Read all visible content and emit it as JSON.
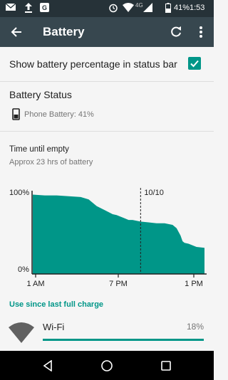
{
  "status_bar": {
    "network_label": "4G",
    "battery_percent": "41%",
    "time": "1:53",
    "icons": [
      "mail-icon",
      "upload-icon",
      "google-icon",
      "alarm-icon",
      "wifi-icon",
      "signal-icon",
      "battery-icon"
    ]
  },
  "toolbar": {
    "title": "Battery"
  },
  "settings": {
    "show_pct_label": "Show battery percentage in status bar",
    "show_pct_checked": true
  },
  "battery_status": {
    "title": "Battery Status",
    "text": "Phone Battery: 41%"
  },
  "time_until_empty": {
    "title": "Time until empty",
    "subtitle": "Approx 23 hrs of battery"
  },
  "chart_data": {
    "type": "area",
    "title": "",
    "xlabel": "",
    "ylabel": "",
    "y_tick_labels": [
      "100%",
      "0%"
    ],
    "x_tick_labels": [
      "1 AM",
      "7 PM",
      "1 PM"
    ],
    "marker_label": "10/10",
    "ylim": [
      0,
      100
    ],
    "series": [
      {
        "x": [
          0,
          3,
          6,
          9,
          12,
          14,
          16,
          18,
          20,
          21,
          22,
          23,
          24,
          25,
          26,
          27,
          29,
          31,
          33,
          35,
          36,
          37,
          37.5,
          38,
          39,
          40,
          41,
          43
        ],
        "values": [
          97,
          96,
          96,
          95,
          94,
          91,
          83,
          78,
          73,
          72,
          70,
          68,
          66,
          66,
          65,
          64,
          63,
          62,
          62,
          60,
          56,
          47,
          40,
          38,
          37,
          35,
          33,
          32
        ]
      }
    ],
    "x_max": 43,
    "marker_x": 27,
    "color": "#009688"
  },
  "usage": {
    "heading": "Use since last full charge",
    "items": [
      {
        "label": "Wi-Fi",
        "percent": "18%",
        "fraction": 1.0
      }
    ]
  },
  "colors": {
    "accent": "#009688",
    "toolbar": "#37474f",
    "status_bar": "#263238"
  }
}
